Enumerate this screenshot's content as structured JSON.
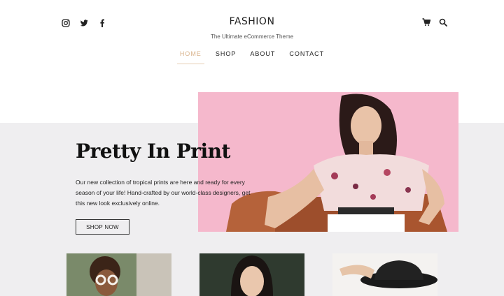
{
  "header": {
    "title": "FASHION",
    "tagline": "The Ultimate eCommerce Theme",
    "social_icons": [
      "instagram-icon",
      "twitter-icon",
      "facebook-icon"
    ],
    "tool_icons": [
      "cart-icon",
      "search-icon"
    ]
  },
  "nav": {
    "items": [
      {
        "label": "HOME",
        "active": true
      },
      {
        "label": "SHOP",
        "active": false
      },
      {
        "label": "ABOUT",
        "active": false
      },
      {
        "label": "CONTACT",
        "active": false
      }
    ]
  },
  "hero": {
    "title": "Pretty In Print",
    "copy": "Our new collection of tropical prints are here and ready for every season of your life! Hand-crafted by our world-class designers, get this new look exclusively online.",
    "button_label": "SHOP NOW"
  },
  "colors": {
    "accent": "#d9b38c",
    "hero_background": "#efeef0",
    "photo_pink": "#f5b8cc"
  }
}
